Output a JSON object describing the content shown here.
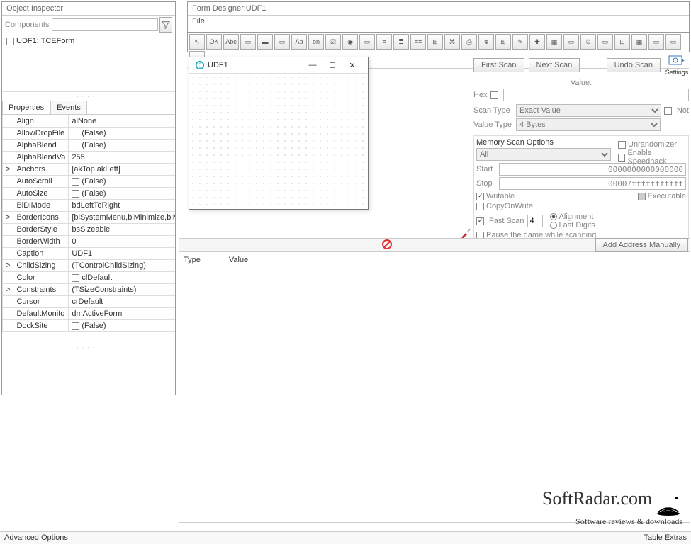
{
  "inspector": {
    "title": "Object Inspector",
    "componentsLabel": "Components",
    "node": "UDF1: TCEForm",
    "tabs": {
      "properties": "Properties",
      "events": "Events"
    },
    "props": [
      {
        "name": "Align",
        "value": "alNone",
        "expand": ""
      },
      {
        "name": "AllowDropFile",
        "value": "(False)",
        "expand": "",
        "checkbox": true
      },
      {
        "name": "AlphaBlend",
        "value": "(False)",
        "expand": "",
        "checkbox": true
      },
      {
        "name": "AlphaBlendVa",
        "value": "255",
        "expand": ""
      },
      {
        "name": "Anchors",
        "value": "[akTop,akLeft]",
        "expand": ">"
      },
      {
        "name": "AutoScroll",
        "value": "(False)",
        "expand": "",
        "checkbox": true
      },
      {
        "name": "AutoSize",
        "value": "(False)",
        "expand": "",
        "checkbox": true
      },
      {
        "name": "BiDiMode",
        "value": "bdLeftToRight",
        "expand": ""
      },
      {
        "name": "BorderIcons",
        "value": "[biSystemMenu,biMinimize,biM",
        "expand": ">"
      },
      {
        "name": "BorderStyle",
        "value": "bsSizeable",
        "expand": ""
      },
      {
        "name": "BorderWidth",
        "value": "0",
        "expand": ""
      },
      {
        "name": "Caption",
        "value": "UDF1",
        "expand": ""
      },
      {
        "name": "ChildSizing",
        "value": "(TControlChildSizing)",
        "expand": ">"
      },
      {
        "name": "Color",
        "value": "clDefault",
        "expand": "",
        "checkbox": true
      },
      {
        "name": "Constraints",
        "value": "(TSizeConstraints)",
        "expand": ">"
      },
      {
        "name": "Cursor",
        "value": "crDefault",
        "expand": ""
      },
      {
        "name": "DefaultMonito",
        "value": "dmActiveForm",
        "expand": ""
      },
      {
        "name": "DockSite",
        "value": "(False)",
        "expand": "",
        "checkbox": true
      }
    ]
  },
  "formDesigner": {
    "title": "Form Designer:UDF1",
    "menuFile": "File",
    "winTitle": "UDF1"
  },
  "ce": {
    "firstScan": "First Scan",
    "nextScan": "Next Scan",
    "undoScan": "Undo Scan",
    "settings": "Settings",
    "valueLabel": "Value:",
    "hex": "Hex",
    "scanType": "Scan Type",
    "scanTypeVal": "Exact Value",
    "not": "Not",
    "valueType": "Value Type",
    "valueTypeVal": "4 Bytes",
    "memOptions": "Memory Scan Options",
    "memOptionsVal": "All",
    "start": "Start",
    "startVal": "0000000000000000",
    "stop": "Stop",
    "stopVal": "00007fffffffffff",
    "writable": "Writable",
    "executable": "Executable",
    "copyOnWrite": "CopyOnWrite",
    "fastScan": "Fast Scan",
    "fastScanVal": "4",
    "alignment": "Alignment",
    "lastDigits": "Last Digits",
    "pause": "Pause the game while scanning",
    "unrandomizer": "Unrandomizer",
    "speedhack": "Enable Speedhack",
    "addManually": "Add Address Manually",
    "colType": "Type",
    "colValue": "Value"
  },
  "status": {
    "left": "Advanced Options",
    "right": "Table Extras"
  },
  "watermark": {
    "l1": "SoftRadar.com",
    "l2": "Software reviews & downloads"
  }
}
